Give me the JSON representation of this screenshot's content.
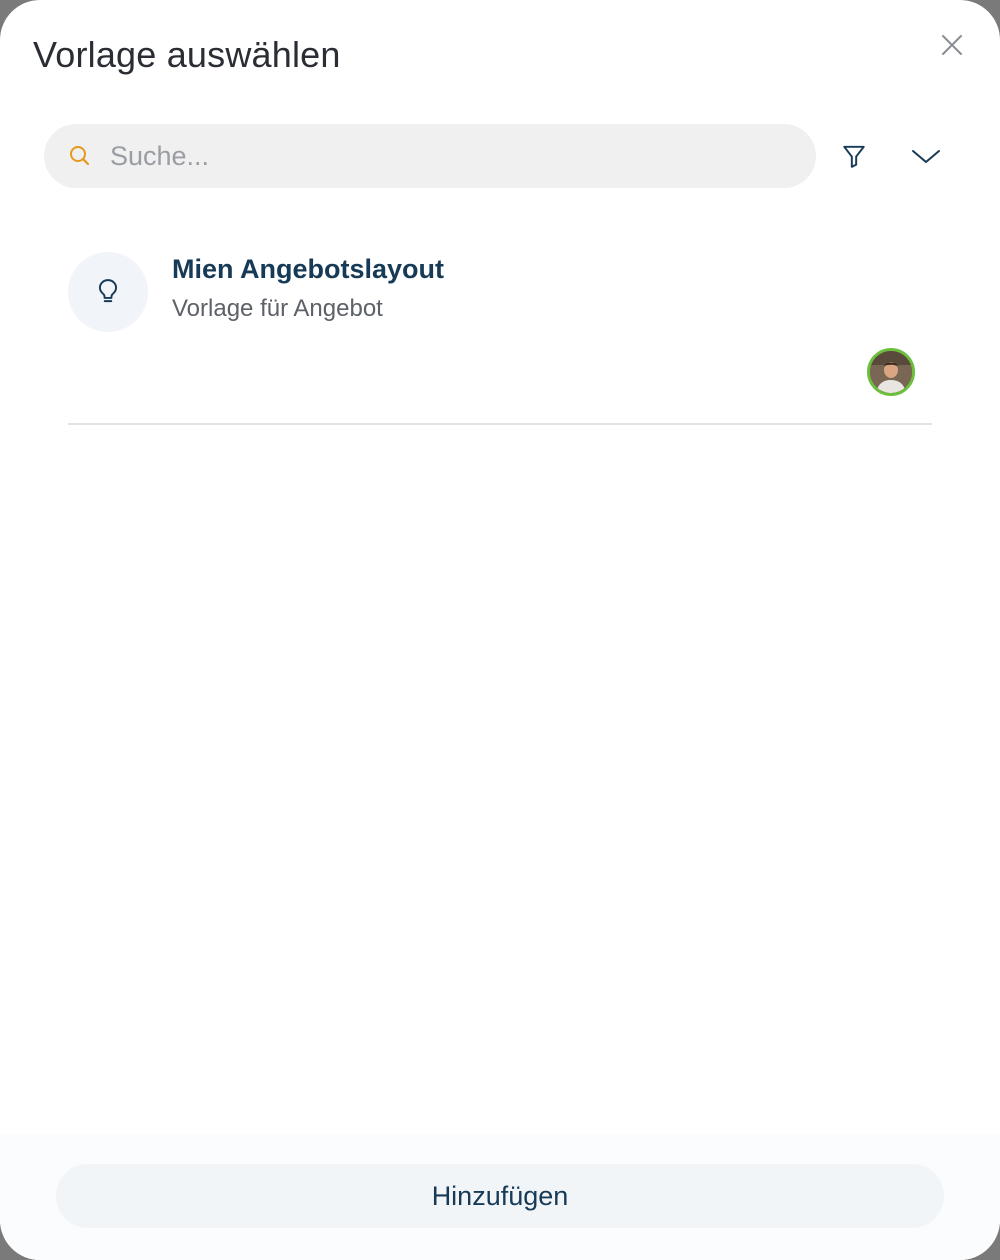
{
  "dialog": {
    "title": "Vorlage auswählen",
    "close_icon": "close-icon"
  },
  "search": {
    "placeholder": "Suche...",
    "value": "",
    "icon": "search-icon"
  },
  "toolbar": {
    "filter_icon": "filter-icon",
    "expand_icon": "chevron-down-icon"
  },
  "templates": [
    {
      "title": "Mien Angebotslayout",
      "subtitle": "Vorlage für Angebot",
      "icon": "lightbulb-icon",
      "avatar": "user-avatar"
    }
  ],
  "footer": {
    "add_label": "Hinzufügen"
  },
  "colors": {
    "title_text": "#173a56",
    "search_accent": "#e59a1c",
    "avatar_ring": "#6cbf3c",
    "divider": "#e3e4e6"
  }
}
